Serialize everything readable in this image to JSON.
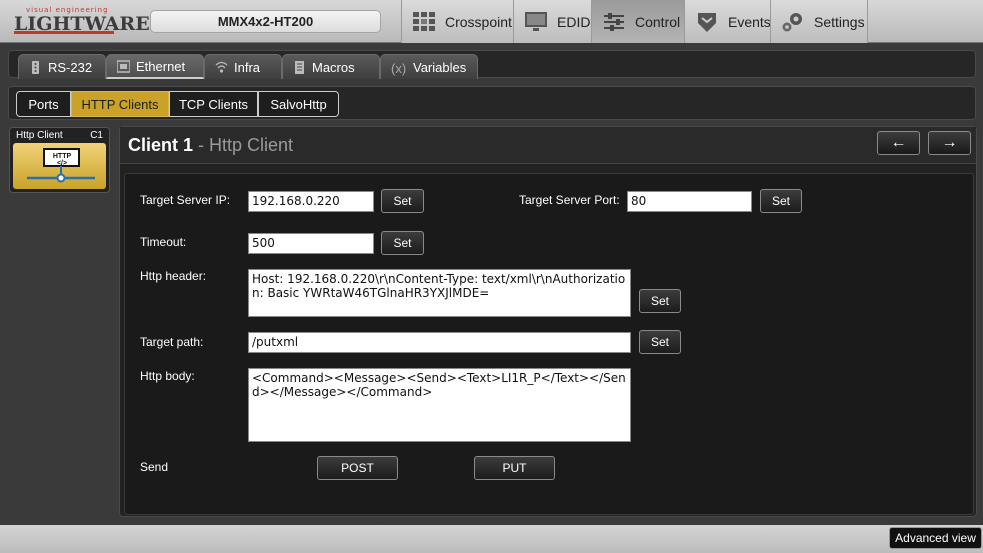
{
  "brand": {
    "tagline": "visual engineering",
    "name": "LIGHTWARE"
  },
  "device": {
    "name": "MMX4x2-HT200"
  },
  "nav": [
    {
      "label": "Crosspoint",
      "icon": "crosspoint-grid-icon"
    },
    {
      "label": "EDID",
      "icon": "monitor-icon"
    },
    {
      "label": "Control",
      "icon": "sliders-icon",
      "active": true
    },
    {
      "label": "Events",
      "icon": "events-shield-icon"
    },
    {
      "label": "Settings",
      "icon": "gears-icon"
    }
  ],
  "tabs": [
    {
      "label": "RS-232",
      "icon": "serial-port-icon"
    },
    {
      "label": "Ethernet",
      "icon": "ethernet-port-icon",
      "active": true
    },
    {
      "label": "Infra",
      "icon": "infrared-icon"
    },
    {
      "label": "Macros",
      "icon": "macro-document-icon"
    },
    {
      "label": "Variables",
      "icon": "variable-x-icon"
    }
  ],
  "subtabs": [
    {
      "label": "Ports"
    },
    {
      "label": "HTTP Clients",
      "active": true
    },
    {
      "label": "TCP Clients"
    },
    {
      "label": "SalvoHttp"
    }
  ],
  "tile": {
    "title": "Http Client",
    "id": "C1",
    "badge": "HTTP </>"
  },
  "panel": {
    "title": "Client 1",
    "separator": " - ",
    "subtitle": "Http Client",
    "prev_icon": "←",
    "next_icon": "→"
  },
  "form": {
    "target_ip_label": "Target Server IP:",
    "target_ip_value": "192.168.0.220",
    "target_port_label": "Target Server Port:",
    "target_port_value": "80",
    "timeout_label": "Timeout:",
    "timeout_value": "500",
    "header_label": "Http header:",
    "header_value": "Host: 192.168.0.220\\r\\nContent-Type: text/xml\\r\\nAuthorization: Basic YWRtaW46TGlnaHR3YXJlMDE=",
    "path_label": "Target path:",
    "path_value": "/putxml",
    "body_label": "Http body:",
    "body_value": "<Command><Message><Send><Text>LI1R_P</Text></Send></Message></Command>",
    "send_label": "Send",
    "set_label": "Set",
    "post_label": "POST",
    "put_label": "PUT"
  },
  "footer": {
    "advanced_label": "Advanced view"
  }
}
